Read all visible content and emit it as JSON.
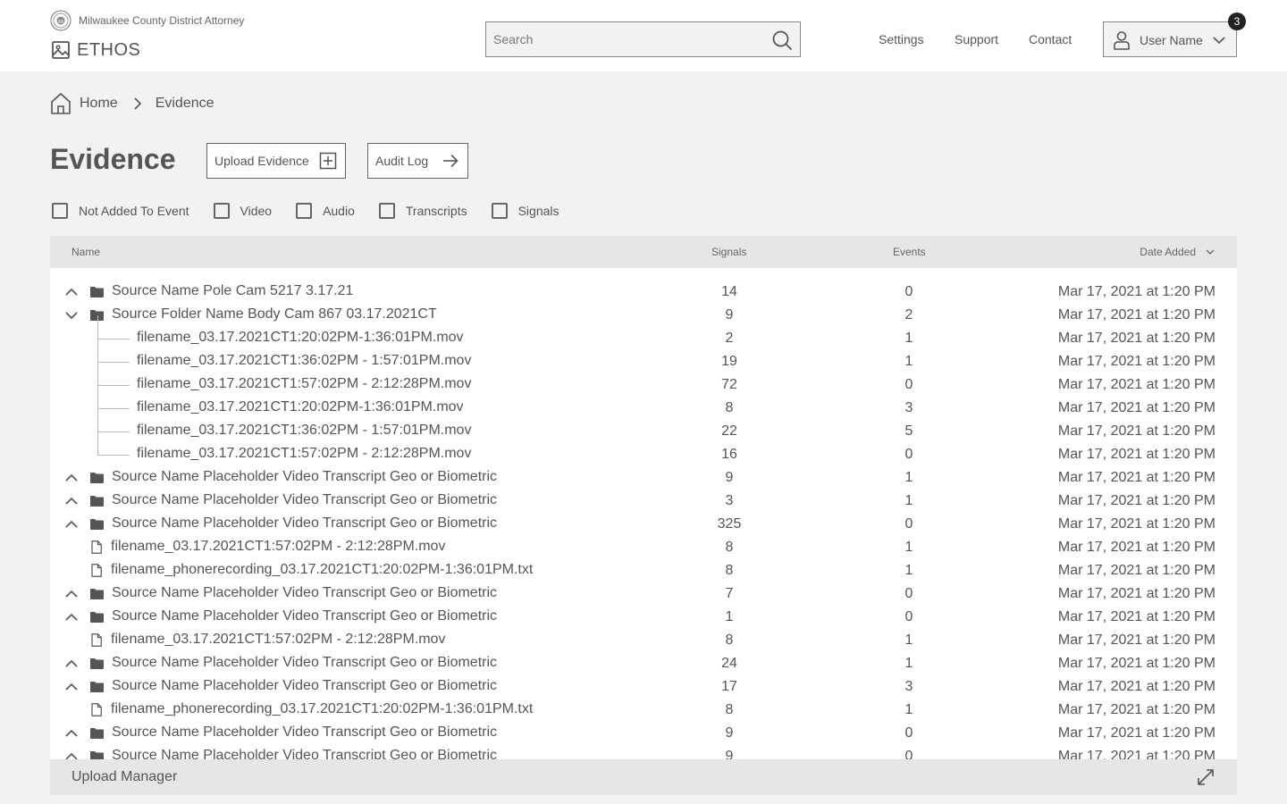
{
  "header": {
    "org_name": "Milwaukee County District Attorney",
    "app_name": "ETHOS",
    "search_placeholder": "Search",
    "nav": {
      "settings": "Settings",
      "support": "Support",
      "contact": "Contact"
    },
    "user_name": "User Name",
    "notification_count": "3"
  },
  "breadcrumb": {
    "home": "Home",
    "current": "Evidence"
  },
  "page": {
    "title": "Evidence",
    "upload_button": "Upload Evidence",
    "audit_button": "Audit Log"
  },
  "filters": [
    "Not Added To Event",
    "Video",
    "Audio",
    "Transcripts",
    "Signals"
  ],
  "table": {
    "columns": {
      "name": "Name",
      "signals": "Signals",
      "events": "Events",
      "date": "Date Added"
    },
    "rows": [
      {
        "kind": "folder",
        "expanded": false,
        "name": "Source Name Pole Cam 5217 3.17.21",
        "signals": "14",
        "events": "0",
        "date": "Mar 17, 2021 at 1:20 PM"
      },
      {
        "kind": "folder",
        "expanded": true,
        "name": "Source Folder Name Body Cam 867 03.17.2021CT",
        "signals": "9",
        "events": "2",
        "date": "Mar 17, 2021 at 1:20 PM"
      },
      {
        "kind": "child",
        "name": "filename_03.17.2021CT1:20:02PM-1:36:01PM.mov",
        "signals": "2",
        "events": "1",
        "date": "Mar 17, 2021 at 1:20 PM"
      },
      {
        "kind": "child",
        "name": "filename_03.17.2021CT1:36:02PM - 1:57:01PM.mov",
        "signals": "19",
        "events": "1",
        "date": "Mar 17, 2021 at 1:20 PM"
      },
      {
        "kind": "child",
        "name": "filename_03.17.2021CT1:57:02PM - 2:12:28PM.mov",
        "signals": "72",
        "events": "0",
        "date": "Mar 17, 2021 at 1:20 PM"
      },
      {
        "kind": "child",
        "name": "filename_03.17.2021CT1:20:02PM-1:36:01PM.mov",
        "signals": "8",
        "events": "3",
        "date": "Mar 17, 2021 at 1:20 PM"
      },
      {
        "kind": "child",
        "name": "filename_03.17.2021CT1:36:02PM - 1:57:01PM.mov",
        "signals": "22",
        "events": "5",
        "date": "Mar 17, 2021 at 1:20 PM"
      },
      {
        "kind": "child",
        "name": "filename_03.17.2021CT1:57:02PM - 2:12:28PM.mov",
        "signals": "16",
        "events": "0",
        "date": "Mar 17, 2021 at 1:20 PM"
      },
      {
        "kind": "folder",
        "expanded": false,
        "name": "Source Name Placeholder Video Transcript Geo or Biometric",
        "signals": "9",
        "events": "1",
        "date": "Mar 17, 2021 at 1:20 PM"
      },
      {
        "kind": "folder",
        "expanded": false,
        "name": "Source Name Placeholder Video Transcript Geo or Biometric",
        "signals": "3",
        "events": "1",
        "date": "Mar 17, 2021 at 1:20 PM"
      },
      {
        "kind": "folder",
        "expanded": false,
        "name": "Source Name Placeholder Video Transcript Geo or Biometric",
        "signals": "325",
        "events": "0",
        "date": "Mar 17, 2021 at 1:20 PM"
      },
      {
        "kind": "file",
        "name": "filename_03.17.2021CT1:57:02PM - 2:12:28PM.mov",
        "signals": "8",
        "events": "1",
        "date": "Mar 17, 2021 at 1:20 PM"
      },
      {
        "kind": "file",
        "name": "filename_phonerecording_03.17.2021CT1:20:02PM-1:36:01PM.txt",
        "signals": "8",
        "events": "1",
        "date": "Mar 17, 2021 at 1:20 PM"
      },
      {
        "kind": "folder",
        "expanded": false,
        "name": "Source Name Placeholder Video Transcript Geo or Biometric",
        "signals": "7",
        "events": "0",
        "date": "Mar 17, 2021 at 1:20 PM"
      },
      {
        "kind": "folder",
        "expanded": false,
        "name": "Source Name Placeholder Video Transcript Geo or Biometric",
        "signals": "1",
        "events": "0",
        "date": "Mar 17, 2021 at 1:20 PM"
      },
      {
        "kind": "file",
        "name": "filename_03.17.2021CT1:57:02PM - 2:12:28PM.mov",
        "signals": "8",
        "events": "1",
        "date": "Mar 17, 2021 at 1:20 PM"
      },
      {
        "kind": "folder",
        "expanded": false,
        "name": "Source Name Placeholder Video Transcript Geo or Biometric",
        "signals": "24",
        "events": "1",
        "date": "Mar 17, 2021 at 1:20 PM"
      },
      {
        "kind": "folder",
        "expanded": false,
        "name": "Source Name Placeholder Video Transcript Geo or Biometric",
        "signals": "17",
        "events": "3",
        "date": "Mar 17, 2021 at 1:20 PM"
      },
      {
        "kind": "file",
        "name": "filename_phonerecording_03.17.2021CT1:20:02PM-1:36:01PM.txt",
        "signals": "8",
        "events": "1",
        "date": "Mar 17, 2021 at 1:20 PM"
      },
      {
        "kind": "folder",
        "expanded": false,
        "name": "Source Name Placeholder Video Transcript Geo or Biometric",
        "signals": "9",
        "events": "0",
        "date": "Mar 17, 2021 at 1:20 PM"
      },
      {
        "kind": "folder",
        "expanded": false,
        "name": "Source Name Placeholder Video Transcript Geo or Biometric",
        "signals": "9",
        "events": "0",
        "date": "Mar 17, 2021 at 1:20 PM"
      }
    ]
  },
  "upload_manager": {
    "label": "Upload Manager"
  }
}
